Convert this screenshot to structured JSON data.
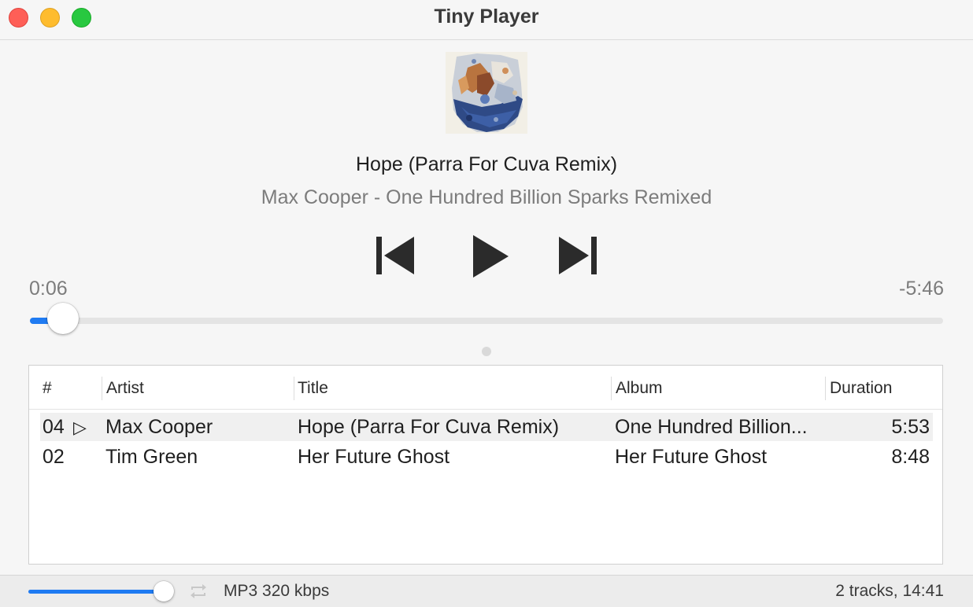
{
  "window": {
    "title": "Tiny Player"
  },
  "now_playing": {
    "title": "Hope (Parra For Cuva Remix)",
    "subtitle": "Max Cooper - One Hundred Billion Sparks Remixed",
    "elapsed": "0:06",
    "remaining": "-5:46",
    "progress_fraction": 0.036
  },
  "controls": {
    "previous_icon": "skip-previous-icon",
    "play_icon": "play-icon",
    "next_icon": "skip-next-icon"
  },
  "playlist": {
    "columns": [
      "#",
      "Artist",
      "Title",
      "Album",
      "Duration"
    ],
    "rows": [
      {
        "number": "04",
        "playing_indicator": "▷",
        "artist": "Max Cooper",
        "title": "Hope (Parra For Cuva Remix)",
        "album": "One Hundred Billion...",
        "duration": "5:53",
        "playing": true
      },
      {
        "number": "02",
        "playing_indicator": "",
        "artist": "Tim Green",
        "title": "Her Future Ghost",
        "album": "Her Future Ghost",
        "duration": "8:48",
        "playing": false
      }
    ]
  },
  "status_bar": {
    "volume_fraction": 1.0,
    "repeat_icon": "repeat-icon",
    "format": "MP3 320 kbps",
    "summary": "2 tracks, 14:41"
  },
  "colors": {
    "accent": "#1f7bf2",
    "traffic_close": "#fe5f57",
    "traffic_minimize": "#febc2e",
    "traffic_maximize": "#28c840"
  }
}
